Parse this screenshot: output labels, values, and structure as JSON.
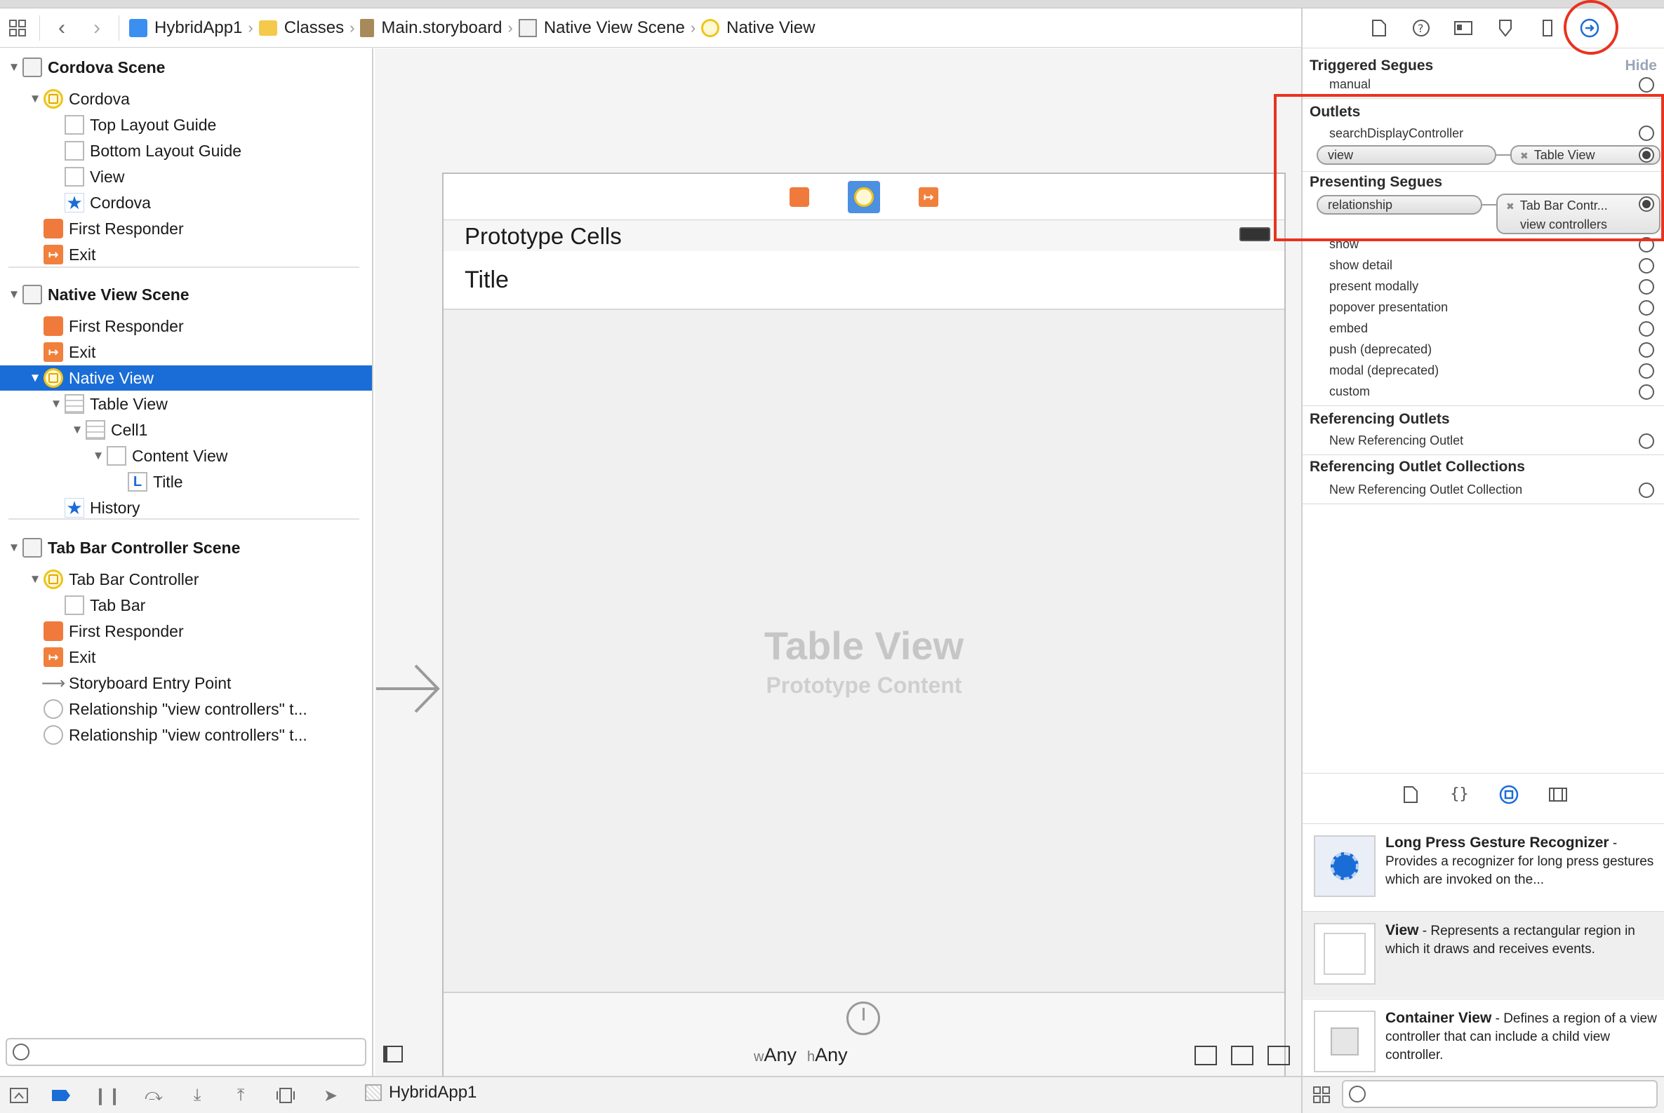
{
  "breadcrumbs": [
    {
      "label": "HybridApp1",
      "icon": "project-icon"
    },
    {
      "label": "Classes",
      "icon": "folder-icon"
    },
    {
      "label": "Main.storyboard",
      "icon": "storyboard-file-icon"
    },
    {
      "label": "Native View Scene",
      "icon": "scene-icon"
    },
    {
      "label": "Native View",
      "icon": "view-controller-icon"
    }
  ],
  "outline": {
    "items": [
      {
        "label": "Cordova Scene",
        "icon": "scene-icon",
        "depth": 0,
        "disclosure": "open",
        "scene": true
      },
      {
        "label": "Cordova",
        "icon": "view-controller-icon",
        "depth": 1,
        "disclosure": "open"
      },
      {
        "label": "Top Layout Guide",
        "icon": "layout-guide-icon",
        "depth": 2
      },
      {
        "label": "Bottom Layout Guide",
        "icon": "layout-guide-icon",
        "depth": 2
      },
      {
        "label": "View",
        "icon": "view-icon",
        "depth": 2
      },
      {
        "label": "Cordova",
        "icon": "tab-bar-item-star-icon",
        "depth": 2
      },
      {
        "label": "First Responder",
        "icon": "first-responder-cube-icon",
        "depth": 1
      },
      {
        "label": "Exit",
        "icon": "exit-icon",
        "depth": 1
      },
      {
        "label": "Native View Scene",
        "icon": "scene-icon",
        "depth": 0,
        "disclosure": "open",
        "scene": true
      },
      {
        "label": "First Responder",
        "icon": "first-responder-cube-icon",
        "depth": 1
      },
      {
        "label": "Exit",
        "icon": "exit-icon",
        "depth": 1
      },
      {
        "label": "Native View",
        "icon": "view-controller-icon",
        "depth": 1,
        "disclosure": "open",
        "selected": true
      },
      {
        "label": "Table View",
        "icon": "table-view-icon",
        "depth": 2,
        "disclosure": "open"
      },
      {
        "label": "Cell1",
        "icon": "table-cell-icon",
        "depth": 3,
        "disclosure": "open"
      },
      {
        "label": "Content View",
        "icon": "view-icon",
        "depth": 4,
        "disclosure": "open"
      },
      {
        "label": "Title",
        "icon": "label-icon",
        "depth": 5
      },
      {
        "label": "History",
        "icon": "tab-bar-item-star-icon",
        "depth": 2
      },
      {
        "label": "Tab Bar Controller Scene",
        "icon": "scene-icon",
        "depth": 0,
        "disclosure": "open",
        "scene": true
      },
      {
        "label": "Tab Bar Controller",
        "icon": "view-controller-icon",
        "depth": 1,
        "disclosure": "open"
      },
      {
        "label": "Tab Bar",
        "icon": "tab-bar-icon",
        "depth": 2
      },
      {
        "label": "First Responder",
        "icon": "first-responder-cube-icon",
        "depth": 1
      },
      {
        "label": "Exit",
        "icon": "exit-icon",
        "depth": 1
      },
      {
        "label": "Storyboard Entry Point",
        "icon": "entry-arrow-icon",
        "depth": 1
      },
      {
        "label": "Relationship \"view controllers\" t...",
        "icon": "relationship-segue-icon",
        "depth": 1
      },
      {
        "label": "Relationship \"view controllers\" t...",
        "icon": "relationship-segue-icon",
        "depth": 1
      }
    ]
  },
  "canvas": {
    "section_header": "Prototype Cells",
    "cell_title": "Title",
    "placeholder_title": "Table View",
    "placeholder_subtitle": "Prototype Content",
    "size_class_w_prefix": "w",
    "size_class_w": "Any",
    "size_class_h_prefix": "h",
    "size_class_h": "Any"
  },
  "inspector": {
    "triggered_segues": {
      "title": "Triggered Segues",
      "hide": "Hide",
      "rows": [
        "manual"
      ]
    },
    "outlets": {
      "title": "Outlets",
      "search_outlet": "searchDisplayController",
      "view_outlet": "view",
      "view_target": "Table View"
    },
    "presenting_segues": {
      "title": "Presenting Segues",
      "relationship": "relationship",
      "target_line1": "Tab Bar Contr...",
      "target_line2": "view controllers",
      "rows": [
        "show",
        "show detail",
        "present modally",
        "popover presentation",
        "embed",
        "push (deprecated)",
        "modal (deprecated)",
        "custom"
      ]
    },
    "referencing_outlets": {
      "title": "Referencing Outlets",
      "row": "New Referencing Outlet"
    },
    "referencing_collections": {
      "title": "Referencing Outlet Collections",
      "row": "New Referencing Outlet Collection"
    }
  },
  "library": [
    {
      "name": "Long Press Gesture Recognizer",
      "desc": " - Provides a recognizer for long press gestures which are invoked on the..."
    },
    {
      "name": "View",
      "desc": " - Represents a rectangular region in which it draws and receives events."
    },
    {
      "name": "Container View",
      "desc": " - Defines a region of a view controller that can include a child view controller."
    }
  ],
  "debug_bar": {
    "scheme": "HybridApp1"
  },
  "colors": {
    "selection": "#1a6dd6",
    "highlight": "#e8331f",
    "accent": "#1a6dd6"
  }
}
